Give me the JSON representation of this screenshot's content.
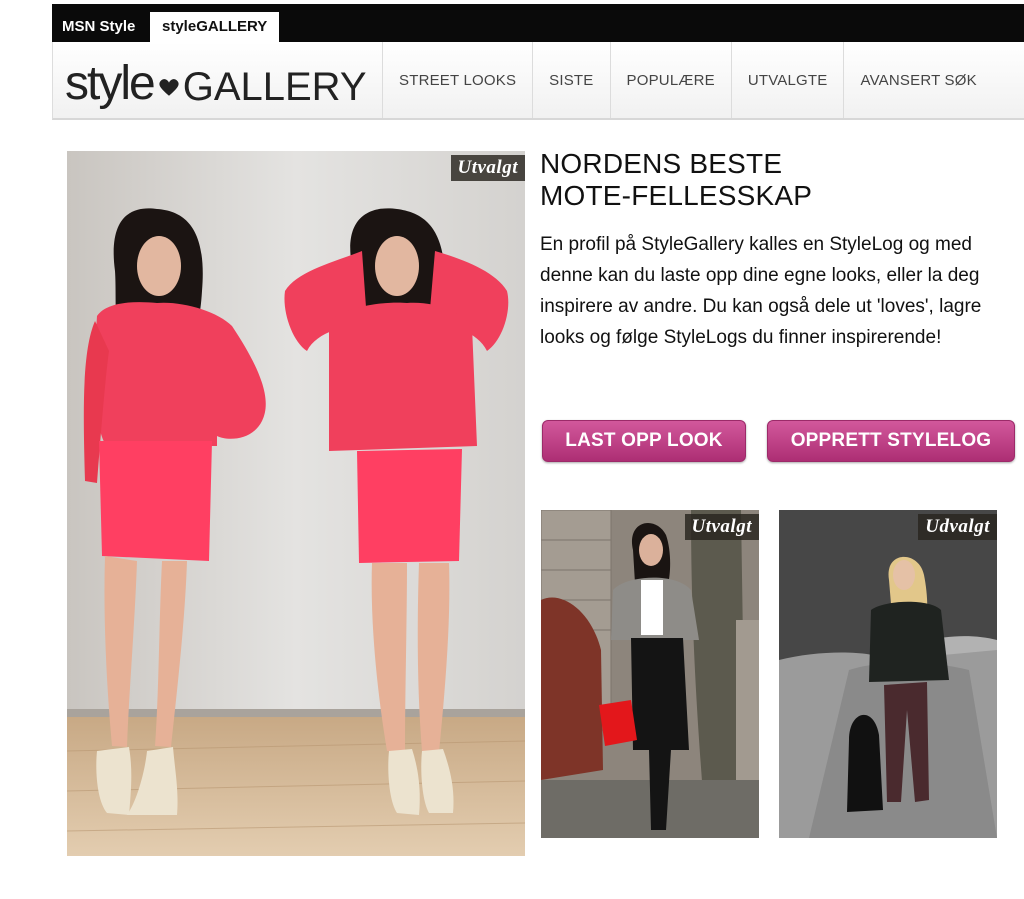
{
  "topbar": {
    "msn_label": "MSN Style",
    "gallery_label": "styleGALLERY"
  },
  "logo": {
    "part1": "style",
    "part2": "GALLERY"
  },
  "nav": {
    "items": [
      "STREET LOOKS",
      "SISTE",
      "POPULÆRE",
      "UTVALGTE",
      "AVANSERT SØK"
    ]
  },
  "hero": {
    "badge": "Utvalgt"
  },
  "intro": {
    "title_line1": "NORDENS BESTE",
    "title_line2": "MOTE-FELLESSKAP",
    "description": "En profil på StyleGallery kalles en StyleLog og med denne kan du laste opp dine egne looks, eller la deg inspirere av andre. Du kan også dele ut 'loves', lagre looks og følge StyleLogs du finner inspirerende!"
  },
  "buttons": {
    "upload": "LAST OPP LOOK",
    "create": "OPPRETT STYLELOG"
  },
  "thumbs": {
    "badge1": "Utvalgt",
    "badge2": "Udvalgt"
  },
  "colors": {
    "accent": "#c0418a",
    "top_bar": "#0a0a0a",
    "dress": "#ee3b5a"
  }
}
